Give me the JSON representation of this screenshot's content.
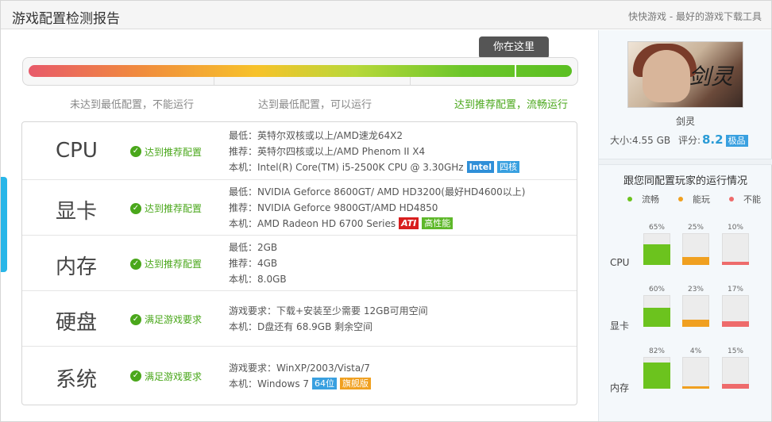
{
  "header": {
    "title": "游戏配置检测报告",
    "tagline": "快快游戏 - 最好的游戏下载工具"
  },
  "progress": {
    "bubble": "你在这里",
    "labels": [
      "未达到最低配置，不能运行",
      "达到最低配置，可以运行",
      "达到推荐配置，流畅运行"
    ],
    "level": 0.88
  },
  "specs": [
    {
      "name": "CPU",
      "status": "达到推荐配置",
      "lines": [
        {
          "text": "最低：英特尔双核或以上/AMD速龙64X2"
        },
        {
          "text": "推荐：英特尔四核或以上/AMD Phenom II X4"
        },
        {
          "text": "本机：Intel(R) Core(TM) i5-2500K CPU @ 3.30GHz",
          "tags": [
            {
              "text": "Intel",
              "style": "intel"
            },
            {
              "text": "四核",
              "style": "blue"
            }
          ]
        }
      ]
    },
    {
      "name": "显卡",
      "status": "达到推荐配置",
      "lines": [
        {
          "text": "最低：NVIDIA Geforce 8600GT/ AMD HD3200(最好HD4600以上)"
        },
        {
          "text": "推荐：NVIDIA Geforce 9800GT/AMD HD4850"
        },
        {
          "text": "本机：AMD Radeon HD 6700 Series",
          "tags": [
            {
              "text": "ATI",
              "style": "red"
            },
            {
              "text": "高性能",
              "style": "green"
            }
          ]
        }
      ]
    },
    {
      "name": "内存",
      "status": "达到推荐配置",
      "lines": [
        {
          "text": "最低：2GB"
        },
        {
          "text": "推荐：4GB"
        },
        {
          "text": "本机：8.0GB"
        }
      ]
    },
    {
      "name": "硬盘",
      "status": "满足游戏要求",
      "lines": [
        {
          "text": "游戏要求：下载+安装至少需要 12GB可用空间"
        },
        {
          "text": "本机：D盘还有 68.9GB 剩余空间"
        }
      ]
    },
    {
      "name": "系统",
      "status": "满足游戏要求",
      "lines": [
        {
          "text": "游戏要求：WinXP/2003/Vista/7"
        },
        {
          "text": "本机：Windows 7",
          "tags": [
            {
              "text": "64位",
              "style": "blue"
            },
            {
              "text": "旗舰版",
              "style": "orange"
            }
          ]
        }
      ]
    }
  ],
  "game": {
    "logo_text": "剑灵",
    "name": "剑灵",
    "size_label": "大小:4.55 GB",
    "rating_label": "评分:",
    "rating": "8.2",
    "rating_badge": "极品"
  },
  "peers": {
    "title": "跟您同配置玩家的运行情况",
    "legend": [
      {
        "label": "流畅",
        "color": "#6cc31e"
      },
      {
        "label": "能玩",
        "color": "#f0a020"
      },
      {
        "label": "不能",
        "color": "#ee6b6b"
      }
    ],
    "groups": [
      {
        "label": "CPU",
        "values": [
          65,
          25,
          10
        ],
        "pct_labels": [
          "65%",
          "25%",
          "10%"
        ]
      },
      {
        "label": "显卡",
        "values": [
          60,
          23,
          17
        ],
        "pct_labels": [
          "60%",
          "23%",
          "17%"
        ]
      },
      {
        "label": "内存",
        "values": [
          82,
          4,
          15
        ],
        "pct_labels": [
          "82%",
          "4%",
          "15%"
        ]
      }
    ]
  }
}
